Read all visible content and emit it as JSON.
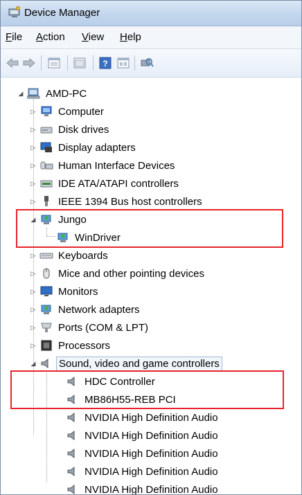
{
  "window": {
    "title": "Device Manager"
  },
  "menu": [
    {
      "key": "F",
      "rest": "ile"
    },
    {
      "key": "A",
      "rest": "ction"
    },
    {
      "key": "V",
      "rest": "iew"
    },
    {
      "key": "H",
      "rest": "elp"
    }
  ],
  "toolbar": {
    "buttons": [
      "back-arrow-icon",
      "forward-arrow-icon",
      "properties-icon",
      "show-hide-console-tree-icon",
      "help-icon",
      "computer-view-icon",
      "scan-hardware-changes-icon"
    ]
  },
  "tree": {
    "root": "AMD-PC",
    "items": [
      {
        "label": "Computer",
        "icon": "computer-icon"
      },
      {
        "label": "Disk drives",
        "icon": "disk-drive-icon"
      },
      {
        "label": "Display adapters",
        "icon": "display-adapter-icon"
      },
      {
        "label": "Human Interface Devices",
        "icon": "hid-icon"
      },
      {
        "label": "IDE ATA/ATAPI controllers",
        "icon": "ide-controller-icon"
      },
      {
        "label": "IEEE 1394 Bus host controllers",
        "icon": "ieee1394-icon"
      },
      {
        "label": "Jungo",
        "icon": "jungo-icon"
      },
      {
        "label": "WinDriver",
        "icon": "windriver-icon"
      },
      {
        "label": "Keyboards",
        "icon": "keyboard-icon"
      },
      {
        "label": "Mice and other pointing devices",
        "icon": "mouse-icon"
      },
      {
        "label": "Monitors",
        "icon": "monitor-icon"
      },
      {
        "label": "Network adapters",
        "icon": "network-adapter-icon"
      },
      {
        "label": "Ports (COM & LPT)",
        "icon": "port-icon"
      },
      {
        "label": "Processors",
        "icon": "processor-icon"
      },
      {
        "label": "Sound, video and game controllers",
        "icon": "speaker-icon"
      },
      {
        "label": "HDC Controller",
        "icon": "speaker-icon"
      },
      {
        "label": "MB86H55-REB PCI",
        "icon": "speaker-icon"
      },
      {
        "label": "NVIDIA High Definition Audio",
        "icon": "speaker-icon"
      },
      {
        "label": "NVIDIA High Definition Audio",
        "icon": "speaker-icon"
      },
      {
        "label": "NVIDIA High Definition Audio",
        "icon": "speaker-icon"
      },
      {
        "label": "NVIDIA High Definition Audio",
        "icon": "speaker-icon"
      },
      {
        "label": "NVIDIA High Definition Audio",
        "icon": "speaker-icon"
      }
    ]
  },
  "colors": {
    "highlight": "#e8232b",
    "titlebar": "#c3d6ee"
  }
}
